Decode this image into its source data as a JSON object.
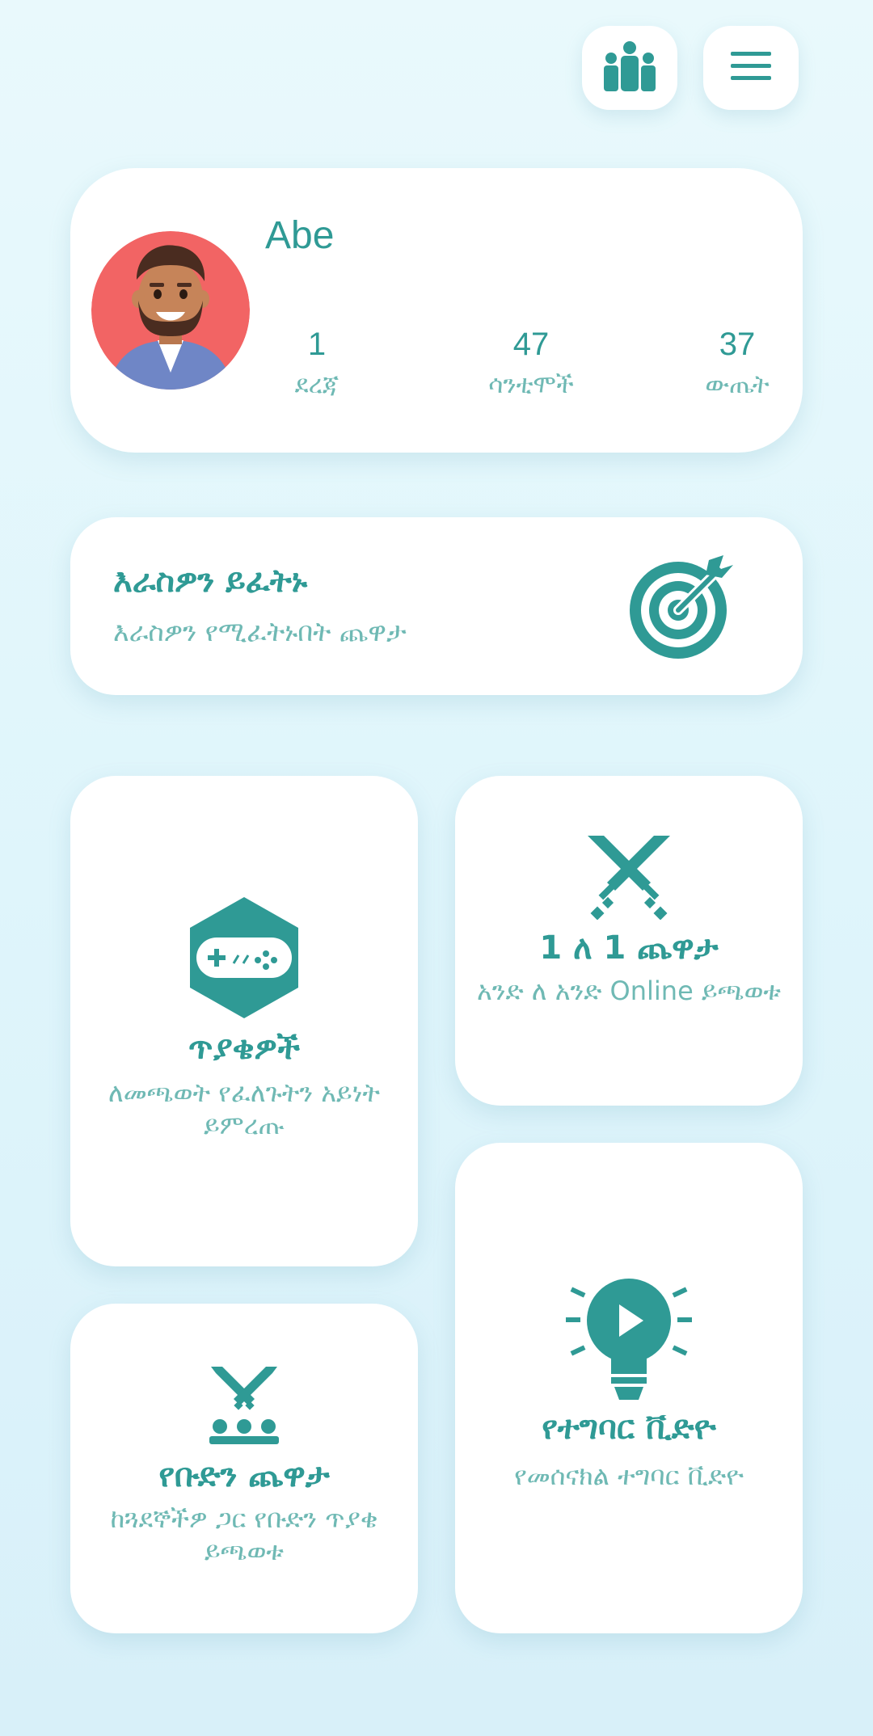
{
  "header": {
    "leaderboard_icon": "group-people-icon",
    "menu_icon": "hamburger-menu-icon"
  },
  "profile": {
    "username": "Abe",
    "avatar": "bearded-man-avatar",
    "stats": [
      {
        "value": "1",
        "label": "ደረጃ"
      },
      {
        "value": "47",
        "label": "ሳንቲሞች"
      },
      {
        "value": "37",
        "label": "ውጤት"
      }
    ]
  },
  "challenge": {
    "title": "እራስዎን ይፈትኑ",
    "subtitle": "እራስዎን የሚፈትኑበት ጨዋታ",
    "icon": "target-arrow-icon"
  },
  "cards": {
    "games": {
      "title": "ጥያቄዎች",
      "subtitle": "ለመጫወት የፈለጉትን አይነት ይምረጡ",
      "icon": "gamepad-hexagon-icon"
    },
    "one_v_one": {
      "title": "1 ለ 1 ጨዋታ",
      "subtitle": "አንድ ለ አንድ Online ይጫወቱ",
      "icon": "crossed-swords-icon"
    },
    "team": {
      "title": "የቡድን ጨዋታ",
      "subtitle": "ከጓደኞችዎ ጋር የቡድን ጥያቄ ይጫወቱ",
      "icon": "swords-team-icon"
    },
    "video": {
      "title": "የተግባር ቪድዮ",
      "subtitle": "የመሰናክል ተግባር ቪድዮ",
      "icon": "lightbulb-play-icon"
    }
  },
  "colors": {
    "primary": "#2f9a95",
    "secondary_text": "#6fb9b4",
    "card_bg": "#ffffff",
    "page_bg": "#e2f6fb",
    "avatar_bg": "#f26464"
  }
}
